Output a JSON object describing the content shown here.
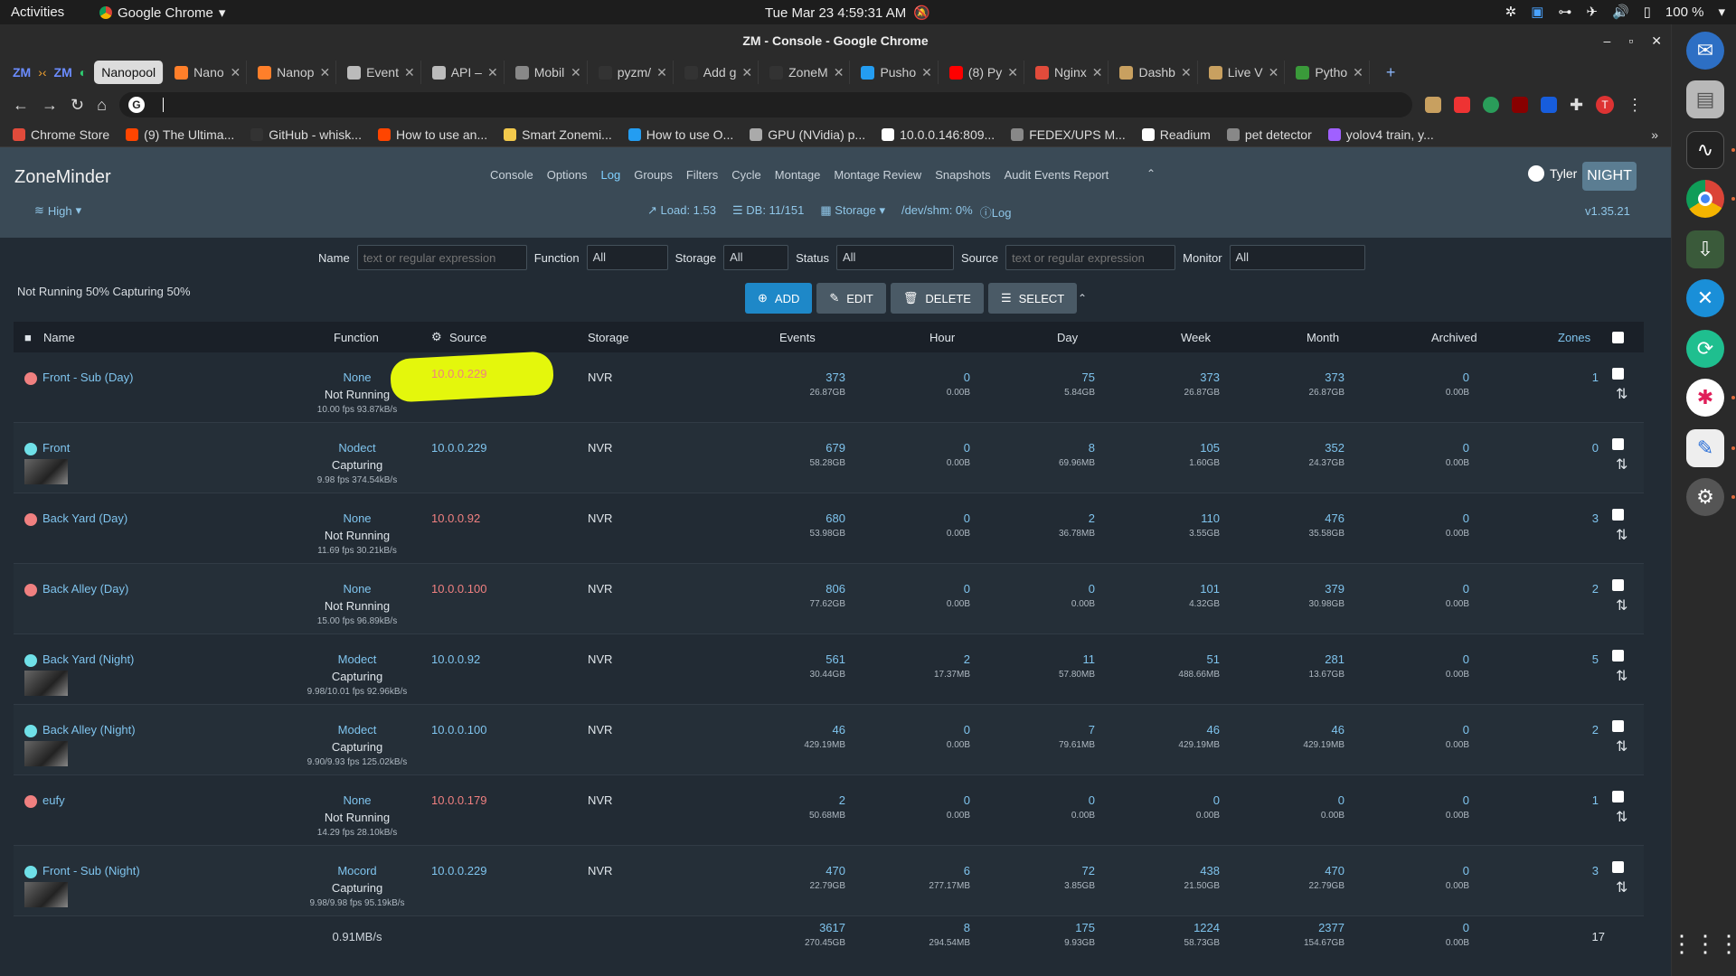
{
  "os": {
    "activities": "Activities",
    "app_name": "Google Chrome",
    "clock": "Tue Mar 23  4:59:31 AM",
    "battery": "100 %"
  },
  "chrome": {
    "window_title": "ZM - Console - Google Chrome",
    "tabs": [
      {
        "label": "Nanopool",
        "color": "#888888",
        "active": true
      },
      {
        "label": "Nano",
        "color": "#ff7f2a"
      },
      {
        "label": "Nanop",
        "color": "#ff7f2a"
      },
      {
        "label": "Event",
        "color": "#bbbbbb"
      },
      {
        "label": "API –",
        "color": "#bbbbbb"
      },
      {
        "label": "Mobil",
        "color": "#888888"
      },
      {
        "label": "pyzm/",
        "color": "#333333"
      },
      {
        "label": "Add g",
        "color": "#333333"
      },
      {
        "label": "ZoneM",
        "color": "#333333"
      },
      {
        "label": "Pusho",
        "color": "#249df1"
      },
      {
        "label": "(8) Py",
        "color": "#ff0000"
      },
      {
        "label": "Nginx",
        "color": "#e14b3b"
      },
      {
        "label": "Dashb",
        "color": "#c8a060"
      },
      {
        "label": "Live V",
        "color": "#c8a060"
      },
      {
        "label": "Pytho",
        "color": "#3a9a3a"
      }
    ],
    "new_tab": "+",
    "omnibox_value": "",
    "bookmarks": [
      {
        "label": "Chrome Store",
        "color": "#e14b3b"
      },
      {
        "label": "(9) The Ultima...",
        "color": "#ff4500"
      },
      {
        "label": "GitHub - whisk...",
        "color": "#333333"
      },
      {
        "label": "How to use an...",
        "color": "#ff4500"
      },
      {
        "label": "Smart Zonemi...",
        "color": "#f2c94c"
      },
      {
        "label": "How to use O...",
        "color": "#249df1"
      },
      {
        "label": "GPU (NVidia) p...",
        "color": "#aaaaaa"
      },
      {
        "label": "10.0.0.146:809...",
        "color": "#ffffff"
      },
      {
        "label": "FEDEX/UPS M...",
        "color": "#888888"
      },
      {
        "label": "Readium",
        "color": "#ffffff"
      },
      {
        "label": "pet detector",
        "color": "#888888"
      },
      {
        "label": "yolov4 train, y...",
        "color": "#a060ff"
      }
    ]
  },
  "zm": {
    "brand": "ZoneMinder",
    "nav": [
      "Console",
      "Options",
      "Log",
      "Groups",
      "Filters",
      "Cycle",
      "Montage",
      "Montage Review",
      "Snapshots",
      "Audit Events Report"
    ],
    "nav_active": "Log",
    "user": "Tyler",
    "night_button": "NIGHT",
    "bandwidth": "High",
    "load": "Load: 1.53",
    "db": "DB: 11/151",
    "storage": "Storage",
    "shm": "/dev/shm: 0%",
    "log": "Log",
    "version": "v1.35.21",
    "filters": {
      "name_label": "Name",
      "name_placeholder": "text or regular expression",
      "function_label": "Function",
      "function_value": "All",
      "storage_label": "Storage",
      "storage_value": "All",
      "status_label": "Status",
      "status_value": "All",
      "source_label": "Source",
      "source_placeholder": "text or regular expression",
      "monitor_label": "Monitor",
      "monitor_value": "All"
    },
    "summary": "Not Running 50% Capturing 50%",
    "actions": {
      "add": "ADD",
      "edit": "EDIT",
      "delete": "DELETE",
      "select": "SELECT"
    },
    "columns": {
      "name": "Name",
      "function": "Function",
      "source": "Source",
      "storage": "Storage",
      "events": "Events",
      "hour": "Hour",
      "day": "Day",
      "week": "Week",
      "month": "Month",
      "archived": "Archived",
      "zones": "Zones"
    },
    "colors": {
      "running": "#6fe0e8",
      "stopped": "#f08080",
      "link": "#7fc4ee",
      "source_stopped": "#f08080"
    },
    "monitors": [
      {
        "name": "Front - Sub (Day)",
        "status_color": "#f08080",
        "thumb": false,
        "function": "None",
        "state": "Not Running",
        "fps": "10.00 fps 93.87kB/s",
        "source": "10.0.0.229",
        "source_color": "#f08080",
        "storage": "NVR",
        "events": "373",
        "events_s": "26.87GB",
        "hour": "0",
        "hour_s": "0.00B",
        "day": "75",
        "day_s": "5.84GB",
        "week": "373",
        "week_s": "26.87GB",
        "month": "373",
        "month_s": "26.87GB",
        "archived": "0",
        "archived_s": "0.00B",
        "zones": "1"
      },
      {
        "name": "Front",
        "status_color": "#6fe0e8",
        "thumb": true,
        "function": "Nodect",
        "state": "Capturing",
        "fps": "9.98 fps 374.54kB/s",
        "source": "10.0.0.229",
        "source_color": "#7fc4ee",
        "storage": "NVR",
        "events": "679",
        "events_s": "58.28GB",
        "hour": "0",
        "hour_s": "0.00B",
        "day": "8",
        "day_s": "69.96MB",
        "week": "105",
        "week_s": "1.60GB",
        "month": "352",
        "month_s": "24.37GB",
        "archived": "0",
        "archived_s": "0.00B",
        "zones": "0"
      },
      {
        "name": "Back Yard (Day)",
        "status_color": "#f08080",
        "thumb": false,
        "function": "None",
        "state": "Not Running",
        "fps": "11.69 fps 30.21kB/s",
        "source": "10.0.0.92",
        "source_color": "#f08080",
        "storage": "NVR",
        "events": "680",
        "events_s": "53.98GB",
        "hour": "0",
        "hour_s": "0.00B",
        "day": "2",
        "day_s": "36.78MB",
        "week": "110",
        "week_s": "3.55GB",
        "month": "476",
        "month_s": "35.58GB",
        "archived": "0",
        "archived_s": "0.00B",
        "zones": "3"
      },
      {
        "name": "Back Alley (Day)",
        "status_color": "#f08080",
        "thumb": false,
        "function": "None",
        "state": "Not Running",
        "fps": "15.00 fps 96.89kB/s",
        "source": "10.0.0.100",
        "source_color": "#f08080",
        "storage": "NVR",
        "events": "806",
        "events_s": "77.62GB",
        "hour": "0",
        "hour_s": "0.00B",
        "day": "0",
        "day_s": "0.00B",
        "week": "101",
        "week_s": "4.32GB",
        "month": "379",
        "month_s": "30.98GB",
        "archived": "0",
        "archived_s": "0.00B",
        "zones": "2"
      },
      {
        "name": "Back Yard (Night)",
        "status_color": "#6fe0e8",
        "thumb": true,
        "function": "Modect",
        "state": "Capturing",
        "fps": "9.98/10.01 fps 92.96kB/s",
        "source": "10.0.0.92",
        "source_color": "#7fc4ee",
        "storage": "NVR",
        "events": "561",
        "events_s": "30.44GB",
        "hour": "2",
        "hour_s": "17.37MB",
        "day": "11",
        "day_s": "57.80MB",
        "week": "51",
        "week_s": "488.66MB",
        "month": "281",
        "month_s": "13.67GB",
        "archived": "0",
        "archived_s": "0.00B",
        "zones": "5"
      },
      {
        "name": "Back Alley (Night)",
        "status_color": "#6fe0e8",
        "thumb": true,
        "function": "Modect",
        "state": "Capturing",
        "fps": "9.90/9.93 fps 125.02kB/s",
        "source": "10.0.0.100",
        "source_color": "#7fc4ee",
        "storage": "NVR",
        "events": "46",
        "events_s": "429.19MB",
        "hour": "0",
        "hour_s": "0.00B",
        "day": "7",
        "day_s": "79.61MB",
        "week": "46",
        "week_s": "429.19MB",
        "month": "46",
        "month_s": "429.19MB",
        "archived": "0",
        "archived_s": "0.00B",
        "zones": "2"
      },
      {
        "name": "eufy",
        "status_color": "#f08080",
        "thumb": false,
        "function": "None",
        "state": "Not Running",
        "fps": "14.29 fps 28.10kB/s",
        "source": "10.0.0.179",
        "source_color": "#f08080",
        "storage": "NVR",
        "events": "2",
        "events_s": "50.68MB",
        "hour": "0",
        "hour_s": "0.00B",
        "day": "0",
        "day_s": "0.00B",
        "week": "0",
        "week_s": "0.00B",
        "month": "0",
        "month_s": "0.00B",
        "archived": "0",
        "archived_s": "0.00B",
        "zones": "1"
      },
      {
        "name": "Front - Sub (Night)",
        "status_color": "#6fe0e8",
        "thumb": true,
        "function": "Mocord",
        "state": "Capturing",
        "fps": "9.98/9.98 fps 95.19kB/s",
        "source": "10.0.0.229",
        "source_color": "#7fc4ee",
        "storage": "NVR",
        "events": "470",
        "events_s": "22.79GB",
        "hour": "6",
        "hour_s": "277.17MB",
        "day": "72",
        "day_s": "3.85GB",
        "week": "438",
        "week_s": "21.50GB",
        "month": "470",
        "month_s": "22.79GB",
        "archived": "0",
        "archived_s": "0.00B",
        "zones": "3"
      }
    ],
    "totals": {
      "bandwidth": "0.91MB/s",
      "events": "3617",
      "events_s": "270.45GB",
      "hour": "8",
      "hour_s": "294.54MB",
      "day": "175",
      "day_s": "9.93GB",
      "week": "1224",
      "week_s": "58.73GB",
      "month": "2377",
      "month_s": "154.67GB",
      "archived": "0",
      "archived_s": "0.00B",
      "zones": "17"
    }
  }
}
